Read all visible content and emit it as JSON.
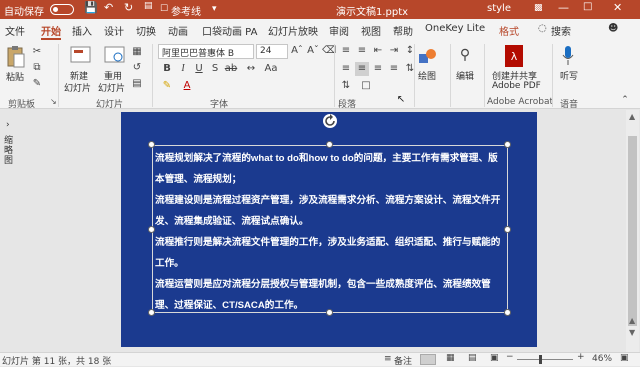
{
  "title_bar": {
    "autosave_label": "自动保存",
    "autosave_state": "关",
    "quick_access": [
      "save-icon",
      "undo-icon",
      "redo-icon",
      "start-from-beginning-icon",
      "reference-line-label"
    ],
    "reference_label": "参考线",
    "doc_title": "演示文稿1.pptx",
    "style_label": "style",
    "context_tab": "格式",
    "accent": "#b7472a"
  },
  "tabs": [
    "文件",
    "开始",
    "插入",
    "设计",
    "切换",
    "动画",
    "口袋动画 PA",
    "幻灯片放映",
    "审阅",
    "视图",
    "帮助",
    "OneKey Lite",
    "格式"
  ],
  "active_tab": "开始",
  "search_label": "搜索",
  "ribbon": {
    "clipboard": {
      "paste": "粘贴",
      "group": "剪贴板"
    },
    "slides": {
      "new_slide_1": "新建",
      "new_slide_2": "幻灯片",
      "reuse_1": "重用",
      "reuse_2": "幻灯片",
      "group": "幻灯片"
    },
    "font": {
      "family": "阿里巴巴普惠体 B",
      "size": "24",
      "group": "字体"
    },
    "paragraph": {
      "group": "段落"
    },
    "drawing": {
      "label": "绘图"
    },
    "editing": {
      "label": "编辑"
    },
    "adobe": {
      "line1": "创建并共享",
      "line2": "Adobe PDF",
      "group": "Adobe Acrobat"
    },
    "voice": {
      "label": "听写",
      "group": "语音"
    }
  },
  "left_pane": {
    "label": "缩略图"
  },
  "slide": {
    "bg_color": "#1b3a8f",
    "paragraphs": [
      "流程规划解决了流程的what to do和how to do的问题，主要工作有需求管理、版本管理、流程规划；",
      "流程建设则是流程过程资产管理，涉及流程需求分析、流程方案设计、流程文件开发、流程集成验证、流程试点确认。",
      "流程推行则是解决流程文件管理的工作，涉及业务适配、组织适配、推行与赋能的工作。",
      "流程运营则是应对流程分层授权与管理机制，包含一些成熟度评估、流程绩效管理、过程保证、CT/SACA的工作。"
    ]
  },
  "status_bar": {
    "slide_info": "幻灯片 第 11 张，共 18 张",
    "notes": "备注",
    "zoom": "46%",
    "zoom_level": 0.46
  }
}
